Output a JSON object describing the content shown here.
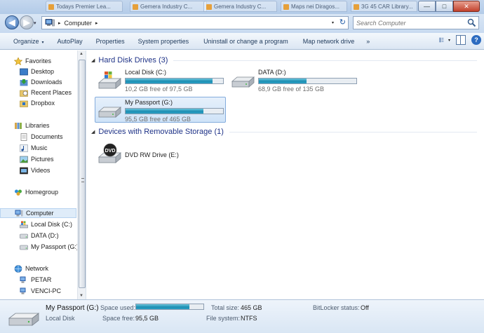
{
  "window": {
    "background_tabs": [
      "Todays Premier Lea...",
      "Gemera Industry C...",
      "Gemera Industry C...",
      "Maps nei Diragos...",
      "3G 45 CAR Library..."
    ],
    "minimize_label": "—",
    "maximize_label": "□",
    "close_label": "✕"
  },
  "address": {
    "back_label": "◀",
    "forward_label": "▶",
    "recent_label": "▾",
    "breadcrumb": "Computer",
    "separator": "▸",
    "dropdown": "▾",
    "refresh": "↻"
  },
  "search": {
    "placeholder": "Search Computer"
  },
  "toolbar": {
    "organize": "Organize",
    "autoplay": "AutoPlay",
    "properties": "Properties",
    "system_properties": "System properties",
    "uninstall": "Uninstall or change a program",
    "map_drive": "Map network drive",
    "more": "»",
    "caret": "▾",
    "help": "?"
  },
  "nav": {
    "favorites": "Favorites",
    "desktop": "Desktop",
    "downloads": "Downloads",
    "recent_places": "Recent Places",
    "dropbox": "Dropbox",
    "libraries": "Libraries",
    "documents": "Documents",
    "music": "Music",
    "pictures": "Pictures",
    "videos": "Videos",
    "homegroup": "Homegroup",
    "computer": "Computer",
    "local_disk": "Local Disk (C:)",
    "data": "DATA (D:)",
    "my_passport": "My Passport (G:)",
    "network": "Network",
    "petar": "PETAR",
    "venci": "VENCI-PC"
  },
  "groups": {
    "hard_disks": "Hard Disk Drives (3)",
    "removable": "Devices with Removable Storage (1)"
  },
  "drives": [
    {
      "name": "Local Disk (C:)",
      "free_text": "10,2 GB free of 97,5 GB",
      "used_fraction": 0.895
    },
    {
      "name": "DATA (D:)",
      "free_text": "68,9 GB free of 135 GB",
      "used_fraction": 0.49
    },
    {
      "name": "My Passport (G:)",
      "free_text": "95,5 GB free of 465 GB",
      "used_fraction": 0.795
    }
  ],
  "dvd": {
    "name": "DVD RW Drive (E:)",
    "badge": "DVD"
  },
  "details": {
    "title": "My Passport (G:)",
    "subtitle": "Local Disk",
    "space_used_label": "Space used:",
    "space_used_fraction": 0.795,
    "space_free_label": "Space free:",
    "space_free_value": "95,5 GB",
    "total_size_label": "Total size:",
    "total_size_value": "465 GB",
    "file_system_label": "File system:",
    "file_system_value": "NTFS",
    "bitlocker_label": "BitLocker status:",
    "bitlocker_value": "Off"
  },
  "colors": {
    "accent": "#1e3287",
    "bar_fill": "#1e8fb3",
    "selection": "#cfe3f8"
  }
}
